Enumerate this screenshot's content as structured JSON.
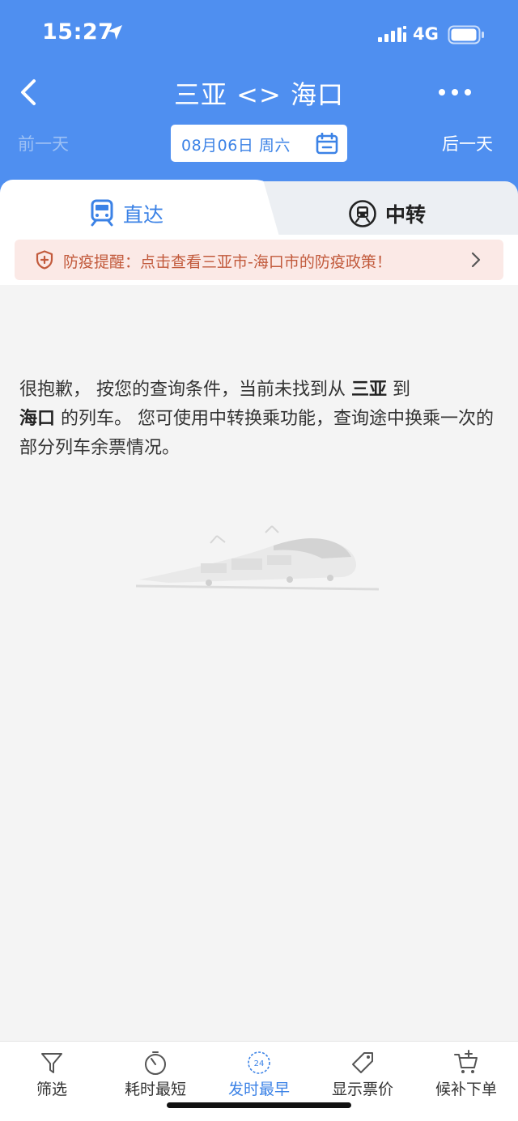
{
  "status_bar": {
    "time": "15:27",
    "network": "4G"
  },
  "nav": {
    "title": "三亚 <> 海口"
  },
  "date_row": {
    "prev": "前一天",
    "date": "08月06日 周六",
    "next": "后一天"
  },
  "tabs": [
    {
      "label": "直达",
      "icon": "train-icon",
      "active": true
    },
    {
      "label": "中转",
      "icon": "transfer-train-icon",
      "active": false
    }
  ],
  "notice": {
    "text": "防疫提醒：点击查看三亚市-海口市的防疫政策！"
  },
  "message": {
    "part1": "很抱歉， 按您的查询条件，当前未找到从 ",
    "from": "三亚",
    "part2": " 到",
    "to": "海口",
    "part3": " 的列车。 您可使用中转换乘功能，查询途中换乘一次的部分列车余票情况。"
  },
  "bottom_bar": {
    "items": [
      {
        "label": "筛选",
        "icon": "filter-icon",
        "active": false
      },
      {
        "label": "耗时最短",
        "icon": "stopwatch-icon",
        "active": false
      },
      {
        "label": "发时最早",
        "icon": "clock-24-icon",
        "icon_text": "24",
        "active": true
      },
      {
        "label": "显示票价",
        "icon": "price-tag-icon",
        "active": false
      },
      {
        "label": "候补下单",
        "icon": "cart-plus-icon",
        "active": false
      }
    ]
  },
  "colors": {
    "header": "#4f8ff0",
    "accent": "#3b82e6",
    "notice_bg": "#fbe9e6",
    "notice_text": "#c25a3c"
  }
}
